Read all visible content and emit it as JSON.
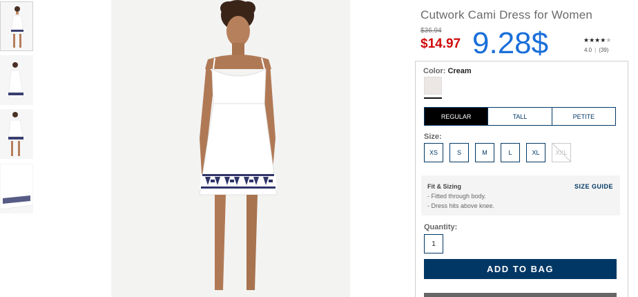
{
  "product": {
    "title": "Cutwork Cami Dress for Women",
    "original_price": "$36.94",
    "sale_price": "$14.97",
    "overlay_price": "9.28$",
    "rating_stars": 4,
    "rating_value": "4.0",
    "review_count": "(39)"
  },
  "color": {
    "label": "Color:",
    "selected": "Cream",
    "swatch_hex": "#ece7e5"
  },
  "fit_tabs": [
    {
      "label": "REGULAR",
      "active": true
    },
    {
      "label": "TALL",
      "active": false
    },
    {
      "label": "PETITE",
      "active": false
    }
  ],
  "size": {
    "label": "Size:",
    "options": [
      {
        "label": "XS",
        "available": true
      },
      {
        "label": "S",
        "available": true
      },
      {
        "label": "M",
        "available": true
      },
      {
        "label": "L",
        "available": true
      },
      {
        "label": "XL",
        "available": true
      },
      {
        "label": "XXL",
        "available": false
      }
    ]
  },
  "fit_sizing": {
    "title": "Fit & Sizing",
    "guide_link": "SIZE GUIDE",
    "lines": [
      "- Fitted through body.",
      "- Dress hits above knee."
    ]
  },
  "quantity": {
    "label": "Quantity:",
    "value": "1"
  },
  "add_to_bag": "ADD TO BAG",
  "colors": {
    "accent_navy": "#003764",
    "sale_red": "#d00a0a",
    "overlay_blue": "#1a6fd9"
  }
}
